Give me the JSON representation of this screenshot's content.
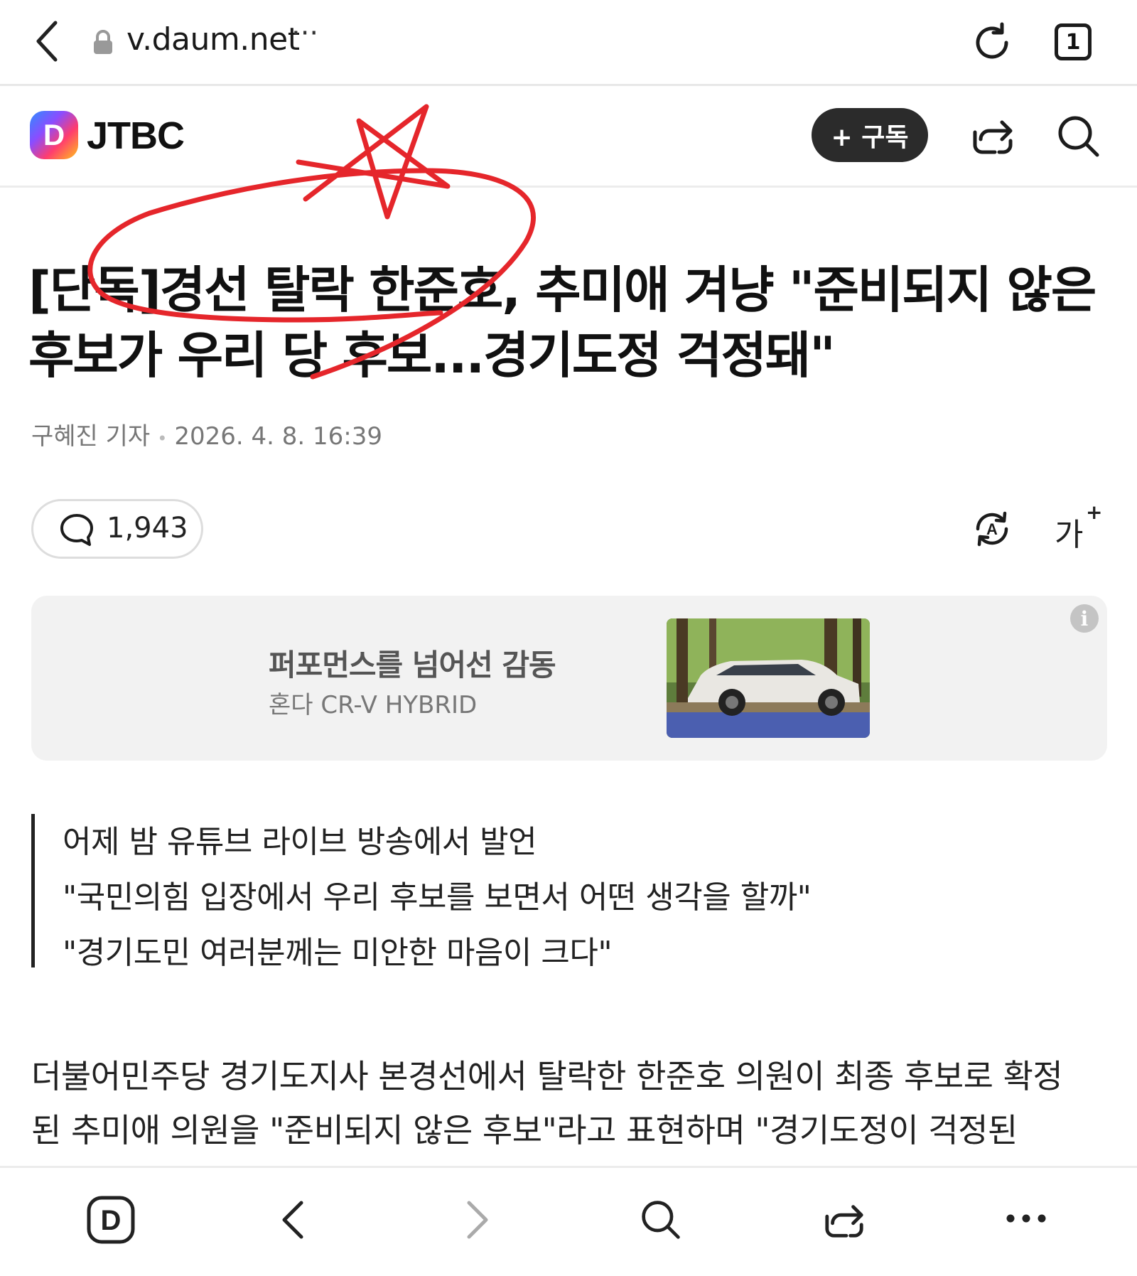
{
  "browser": {
    "url": "v.daum.net",
    "more": "···",
    "tab_count": "1"
  },
  "header": {
    "logo_letter": "D",
    "brand": "JTBC",
    "subscribe_label": "+ 구독"
  },
  "article": {
    "headline_line1": "[단독]경선 탈락 한준호, 추미애 겨냥 \"준비되지 않은",
    "headline_line2": "후보가 우리 당 후보...경기도정 걱정돼\"",
    "reporter": "구혜진 기자",
    "datetime": "2026. 4. 8. 16:39",
    "comment_count": "1,943",
    "font_size_label": "가",
    "font_size_plus": "+",
    "summary": [
      "어제 밤 유튜브 라이브 방송에서 발언",
      "\"국민의힘 입장에서 우리 후보를 보면서 어떤 생각을 할까\"",
      "\"경기도민 여러분께는 미안한 마음이 크다\""
    ],
    "body_lines": [
      "더불어민주당 경기도지사 본경선에서 탈락한 한준호 의원이 최종 후보로 확정",
      "된 추미애 의원을 \"준비되지 않은 후보\"라고 표현하며 \"경기도정이 걱정된"
    ]
  },
  "ad": {
    "title": "퍼포먼스를 넘어선 감동",
    "subtitle": "혼다 CR-V HYBRID",
    "info": "i"
  },
  "colors": {
    "annotation_red": "#e5262b",
    "subscribe_bg": "#2b2b2b",
    "ad_bg": "#f2f2f2"
  },
  "icons": {
    "back": "chevron-left-icon",
    "lock": "lock-icon",
    "reload": "reload-icon",
    "share": "share-icon",
    "search": "search-icon",
    "comment": "speech-bubble-icon",
    "translate": "auto-translate-icon",
    "more": "more-dots-icon",
    "home": "daum-home-icon",
    "forward": "chevron-right-icon"
  }
}
